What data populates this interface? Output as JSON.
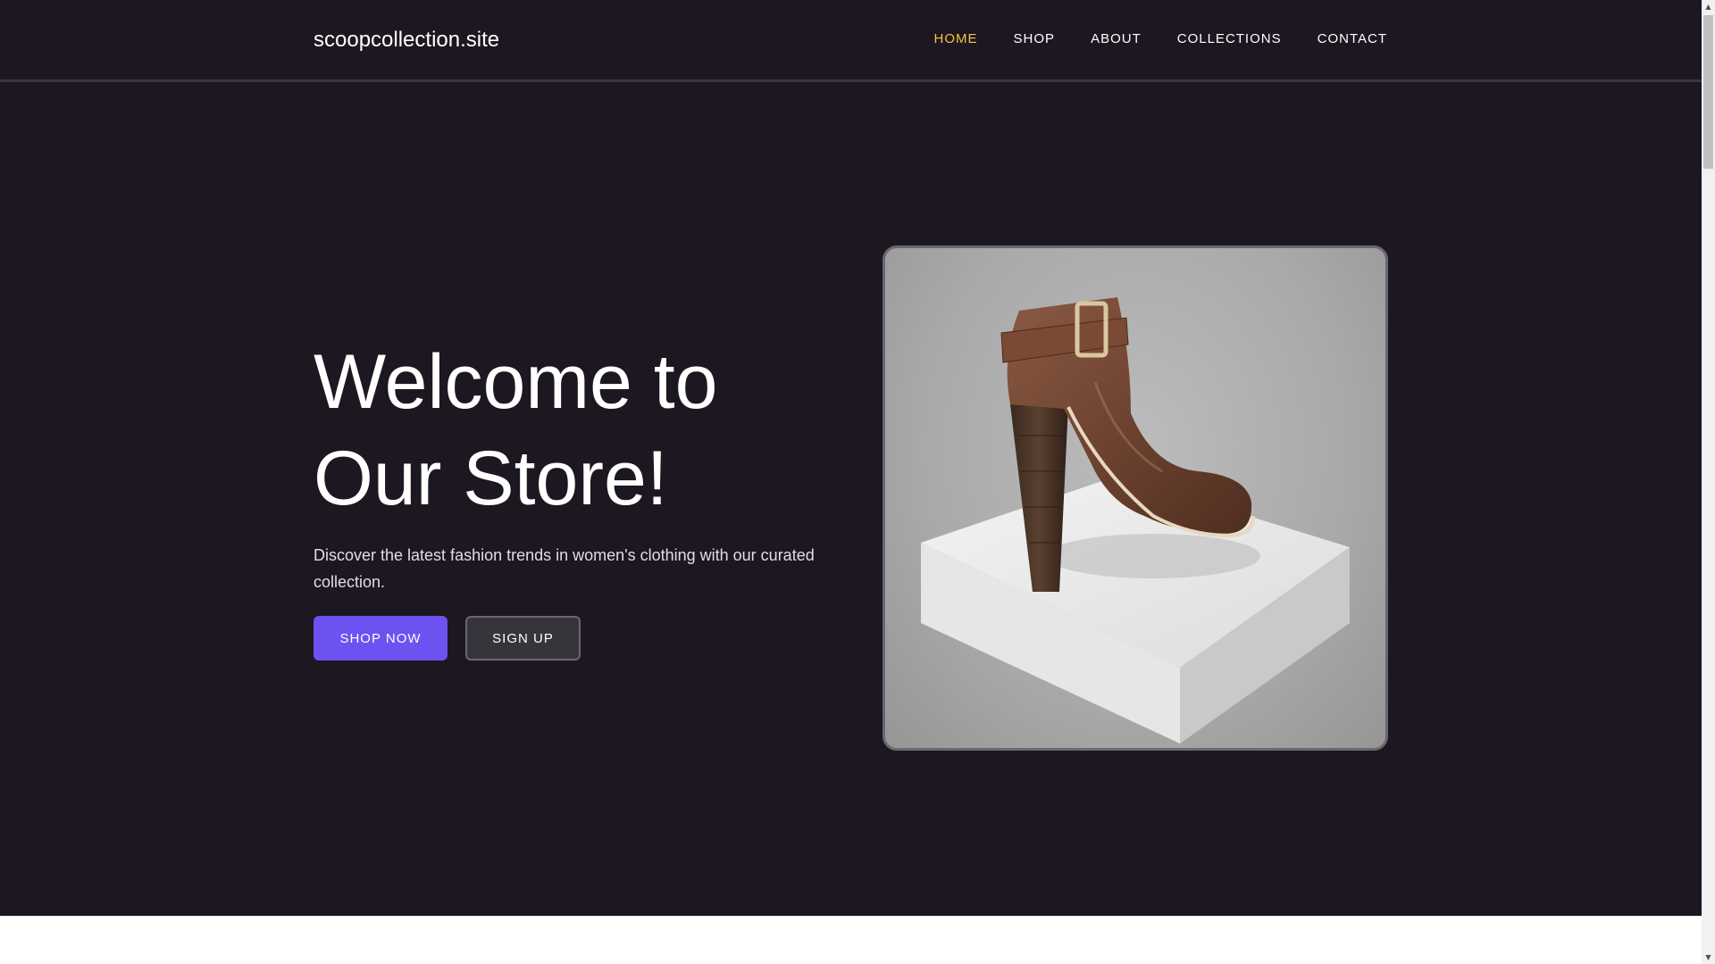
{
  "site": {
    "brand": "scoopcollection.site"
  },
  "nav": {
    "items": [
      {
        "label": "HOME"
      },
      {
        "label": "SHOP"
      },
      {
        "label": "ABOUT"
      },
      {
        "label": "COLLECTIONS"
      },
      {
        "label": "CONTACT"
      }
    ],
    "active_color": "#f5c542"
  },
  "hero": {
    "title_line1": "Welcome to",
    "title_line2": "Our Store!",
    "subtitle": "Discover the latest fashion trends in women's clothing with our curated collection.",
    "primary_button": "SHOP NOW",
    "secondary_button": "SIGN UP",
    "image_subject": "brown leather ankle boot with buckle on white pedestal"
  },
  "colors": {
    "background": "#1c1720",
    "accent": "#6c52f0",
    "secondary_button": "#37343c"
  },
  "icons": {
    "scroll_up": "chevron-up-icon",
    "scroll_down": "chevron-down-icon"
  }
}
